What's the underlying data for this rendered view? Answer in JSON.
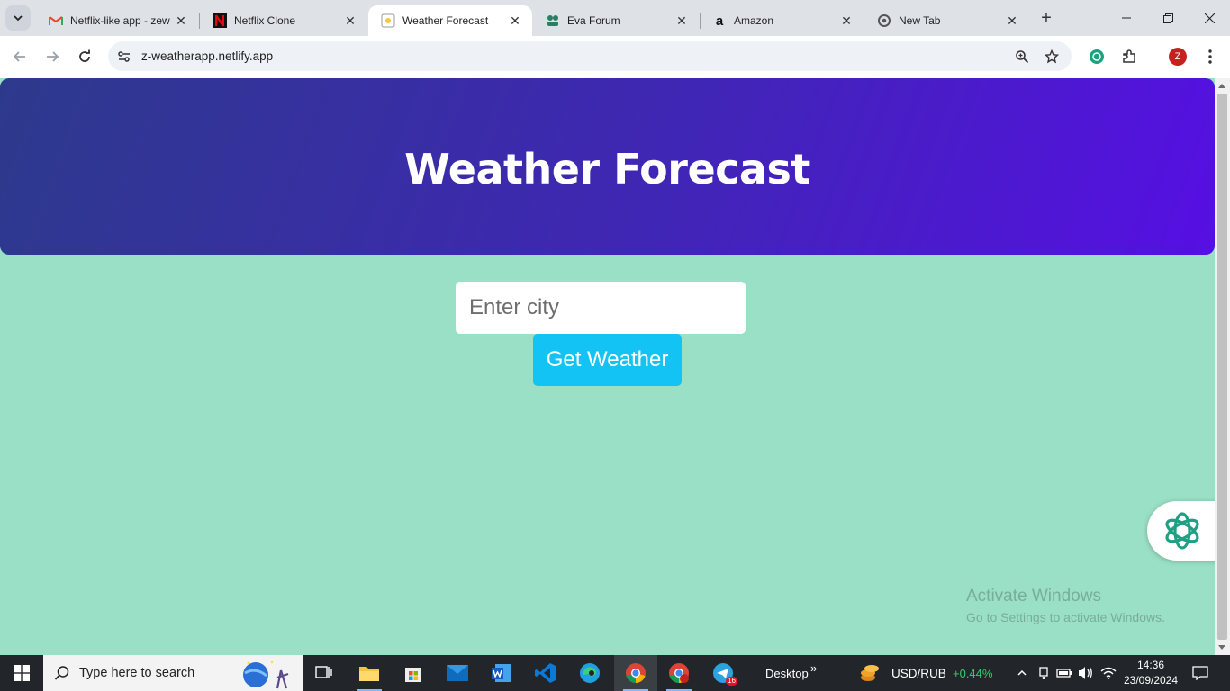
{
  "browser": {
    "tabs": [
      {
        "title": "Netflix-like app - zew",
        "favicon": "gmail-icon",
        "active": false
      },
      {
        "title": "Netflix Clone",
        "favicon": "netflix-icon",
        "active": false
      },
      {
        "title": "Weather Forecast",
        "favicon": "weather-page-icon",
        "active": true
      },
      {
        "title": "Eva Forum",
        "favicon": "forum-icon",
        "active": false
      },
      {
        "title": "Amazon",
        "favicon": "amazon-icon",
        "active": false
      },
      {
        "title": "New Tab",
        "favicon": "chrome-icon",
        "active": false
      }
    ],
    "url": "z-weatherapp.netlify.app",
    "profile_initial": "Z",
    "accent": "#c5221f"
  },
  "page": {
    "heading": "Weather Forecast",
    "city_input": {
      "placeholder": "Enter city",
      "value": ""
    },
    "button_label": "Get Weather",
    "colors": {
      "background": "#9ae0c6",
      "header_start": "#2d3a8c",
      "header_end": "#560fe3",
      "button": "#13c3f4"
    }
  },
  "watermark": {
    "line1": "Activate Windows",
    "line2": "Go to Settings to activate Windows."
  },
  "taskbar": {
    "search_placeholder": "Type here to search",
    "desktop_label": "Desktop",
    "chevrons": "»",
    "ticker_symbol": "USD/RUB",
    "ticker_change": "+0.44%",
    "telegram_badge": "16",
    "time": "14:36",
    "date": "23/09/2024"
  }
}
